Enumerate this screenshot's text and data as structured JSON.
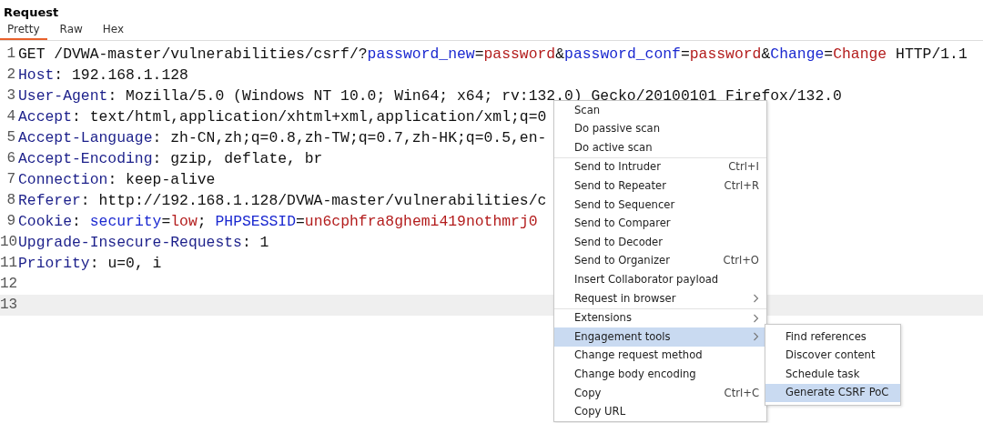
{
  "panel": {
    "title": "Request"
  },
  "tabs": [
    {
      "label": "Pretty",
      "selected": true
    },
    {
      "label": "Raw",
      "selected": false
    },
    {
      "label": "Hex",
      "selected": false
    }
  ],
  "editor": {
    "lines": [
      {
        "number": "1",
        "selected": false,
        "segments": [
          {
            "kind": "plain",
            "text": "GET /DVWA-master/vulnerabilities/csrf/?"
          },
          {
            "kind": "param_name",
            "text": "password_new"
          },
          {
            "kind": "plain",
            "text": "="
          },
          {
            "kind": "param_value",
            "text": "password"
          },
          {
            "kind": "plain",
            "text": "&"
          },
          {
            "kind": "param_name",
            "text": "password_conf"
          },
          {
            "kind": "plain",
            "text": "="
          },
          {
            "kind": "param_value",
            "text": "password"
          },
          {
            "kind": "plain",
            "text": "&"
          },
          {
            "kind": "param_name",
            "text": "Change"
          },
          {
            "kind": "plain",
            "text": "="
          },
          {
            "kind": "param_value",
            "text": "Change"
          },
          {
            "kind": "plain",
            "text": " HTTP/1.1"
          }
        ]
      },
      {
        "number": "2",
        "selected": false,
        "segments": [
          {
            "kind": "header_name",
            "text": "Host"
          },
          {
            "kind": "plain",
            "text": ": 192.168.1.128"
          }
        ]
      },
      {
        "number": "3",
        "selected": false,
        "segments": [
          {
            "kind": "header_name",
            "text": "User-Agent"
          },
          {
            "kind": "plain",
            "text": ": Mozilla/5.0 (Windows NT 10.0; Win64; x64; rv:132.0) Gecko/20100101 Firefox/132.0"
          }
        ]
      },
      {
        "number": "4",
        "selected": false,
        "segments": [
          {
            "kind": "header_name",
            "text": "Accept"
          },
          {
            "kind": "plain",
            "text": ": text/html,application/xhtml+xml,application/xml;q=0"
          }
        ]
      },
      {
        "number": "5",
        "selected": false,
        "segments": [
          {
            "kind": "header_name",
            "text": "Accept-Language"
          },
          {
            "kind": "plain",
            "text": ": zh-CN,zh;q=0.8,zh-TW;q=0.7,zh-HK;q=0.5,en-"
          }
        ]
      },
      {
        "number": "6",
        "selected": false,
        "segments": [
          {
            "kind": "header_name",
            "text": "Accept-Encoding"
          },
          {
            "kind": "plain",
            "text": ": gzip, deflate, br"
          }
        ]
      },
      {
        "number": "7",
        "selected": false,
        "segments": [
          {
            "kind": "header_name",
            "text": "Connection"
          },
          {
            "kind": "plain",
            "text": ": keep-alive"
          }
        ]
      },
      {
        "number": "8",
        "selected": false,
        "segments": [
          {
            "kind": "header_name",
            "text": "Referer"
          },
          {
            "kind": "plain",
            "text": ": http://192.168.1.128/DVWA-master/vulnerabilities/c"
          }
        ]
      },
      {
        "number": "9",
        "selected": false,
        "segments": [
          {
            "kind": "header_name",
            "text": "Cookie"
          },
          {
            "kind": "plain",
            "text": ": "
          },
          {
            "kind": "param_name",
            "text": "security"
          },
          {
            "kind": "plain",
            "text": "="
          },
          {
            "kind": "param_value",
            "text": "low"
          },
          {
            "kind": "plain",
            "text": "; "
          },
          {
            "kind": "param_name",
            "text": "PHPSESSID"
          },
          {
            "kind": "plain",
            "text": "="
          },
          {
            "kind": "param_value",
            "text": "un6cphfra8ghemi419nothmrj0"
          }
        ]
      },
      {
        "number": "10",
        "selected": false,
        "segments": [
          {
            "kind": "header_name",
            "text": "Upgrade-Insecure-Requests"
          },
          {
            "kind": "plain",
            "text": ": 1"
          }
        ]
      },
      {
        "number": "11",
        "selected": false,
        "segments": [
          {
            "kind": "header_name",
            "text": "Priority"
          },
          {
            "kind": "plain",
            "text": ": u=0, i"
          }
        ]
      },
      {
        "number": "12",
        "selected": false
      },
      {
        "number": "13",
        "selected": true
      }
    ]
  },
  "context_menu": {
    "sections": [
      [
        {
          "label": "Scan",
          "selected": false,
          "submenu": false
        },
        {
          "label": "Do passive scan",
          "selected": false,
          "submenu": false
        },
        {
          "label": "Do active scan",
          "selected": false,
          "submenu": false
        }
      ],
      [
        {
          "label": "Send to Intruder",
          "shortcut": "Ctrl+I",
          "selected": false,
          "submenu": false
        },
        {
          "label": "Send to Repeater",
          "shortcut": "Ctrl+R",
          "selected": false,
          "submenu": false
        },
        {
          "label": "Send to Sequencer",
          "selected": false,
          "submenu": false
        },
        {
          "label": "Send to Comparer",
          "selected": false,
          "submenu": false
        },
        {
          "label": "Send to Decoder",
          "selected": false,
          "submenu": false
        },
        {
          "label": "Send to Organizer",
          "shortcut": "Ctrl+O",
          "selected": false,
          "submenu": false
        },
        {
          "label": "Insert Collaborator payload",
          "selected": false,
          "submenu": false
        },
        {
          "label": "Request in browser",
          "selected": false,
          "submenu": true
        }
      ],
      [
        {
          "label": "Extensions",
          "selected": false,
          "submenu": true
        },
        {
          "label": "Engagement tools",
          "selected": true,
          "submenu": true
        },
        {
          "label": "Change request method",
          "selected": false,
          "submenu": false
        },
        {
          "label": "Change body encoding",
          "selected": false,
          "submenu": false
        },
        {
          "label": "Copy",
          "shortcut": "Ctrl+C",
          "selected": false,
          "submenu": false
        },
        {
          "label": "Copy URL",
          "selected": false,
          "submenu": false
        }
      ]
    ]
  },
  "submenu": {
    "items": [
      {
        "label": "Find references",
        "selected": false
      },
      {
        "label": "Discover content",
        "selected": false
      },
      {
        "label": "Schedule task",
        "selected": false
      },
      {
        "label": "Generate CSRF PoC",
        "selected": true
      }
    ]
  }
}
